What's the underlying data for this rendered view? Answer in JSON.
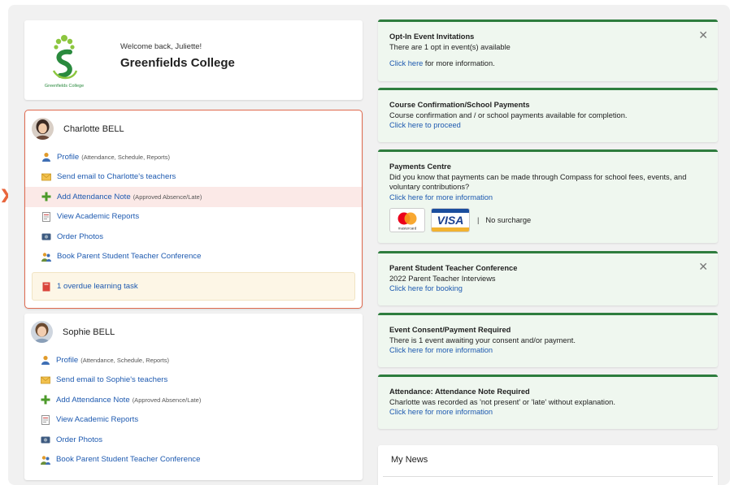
{
  "welcome": {
    "message": "Welcome back, Juliette!",
    "school": "Greenfields College",
    "logo_caption": "Greenfields College"
  },
  "students": [
    {
      "name": "Charlotte BELL",
      "links": [
        {
          "icon": "person-icon",
          "label": "Profile",
          "note": "(Attendance, Schedule, Reports)"
        },
        {
          "icon": "envelope-icon",
          "label": "Send email to Charlotte's teachers",
          "note": ""
        },
        {
          "icon": "plus-icon",
          "label": "Add Attendance Note",
          "note": "(Approved Absence/Late)"
        },
        {
          "icon": "report-icon",
          "label": "View Academic Reports",
          "note": ""
        },
        {
          "icon": "camera-icon",
          "label": "Order Photos",
          "note": ""
        },
        {
          "icon": "people-icon",
          "label": "Book Parent Student Teacher Conference",
          "note": ""
        }
      ],
      "task": "1 overdue learning task"
    },
    {
      "name": "Sophie BELL",
      "links": [
        {
          "icon": "person-icon",
          "label": "Profile",
          "note": "(Attendance, Schedule, Reports)"
        },
        {
          "icon": "envelope-icon",
          "label": "Send email to Sophie's teachers",
          "note": ""
        },
        {
          "icon": "plus-icon",
          "label": "Add Attendance Note",
          "note": "(Approved Absence/Late)"
        },
        {
          "icon": "report-icon",
          "label": "View Academic Reports",
          "note": ""
        },
        {
          "icon": "camera-icon",
          "label": "Order Photos",
          "note": ""
        },
        {
          "icon": "people-icon",
          "label": "Book Parent Student Teacher Conference",
          "note": ""
        }
      ]
    }
  ],
  "notices": [
    {
      "title": "Opt-In Event Invitations",
      "body": "There are 1 opt in event(s) available",
      "link": "Click here",
      "link_rest": " for more information.",
      "closable": true
    },
    {
      "title": "Course Confirmation/School Payments",
      "body": "Course confirmation and / or school payments available for completion.",
      "link": "Click here to proceed",
      "link_rest": "",
      "closable": false
    },
    {
      "title": "Payments Centre",
      "body": "Did you know that payments can be made through Compass for school fees, events, and voluntary contributions?",
      "link": "Click here for more information",
      "link_rest": "",
      "closable": false,
      "cards": {
        "mastercard": "mastercard",
        "visa": "VISA",
        "separator": "|",
        "surcharge": "No surcharge"
      }
    },
    {
      "title": "Parent Student Teacher Conference",
      "body": "2022 Parent Teacher Interviews",
      "link": "Click here for booking",
      "link_rest": "",
      "closable": true
    },
    {
      "title": "Event Consent/Payment Required",
      "body": "There is 1 event awaiting your consent and/or payment.",
      "link": "Click here for more information",
      "link_rest": "",
      "closable": false
    },
    {
      "title": "Attendance: Attendance Note Required",
      "body": "Charlotte was recorded as 'not present' or 'late' without explanation.",
      "link": "Click here for more information",
      "link_rest": "",
      "closable": false
    }
  ],
  "news": {
    "title": "My News"
  },
  "colors": {
    "accent_green": "#2e7d3e",
    "highlight": "#e06a4f",
    "link_blue": "#1e5ab0"
  }
}
